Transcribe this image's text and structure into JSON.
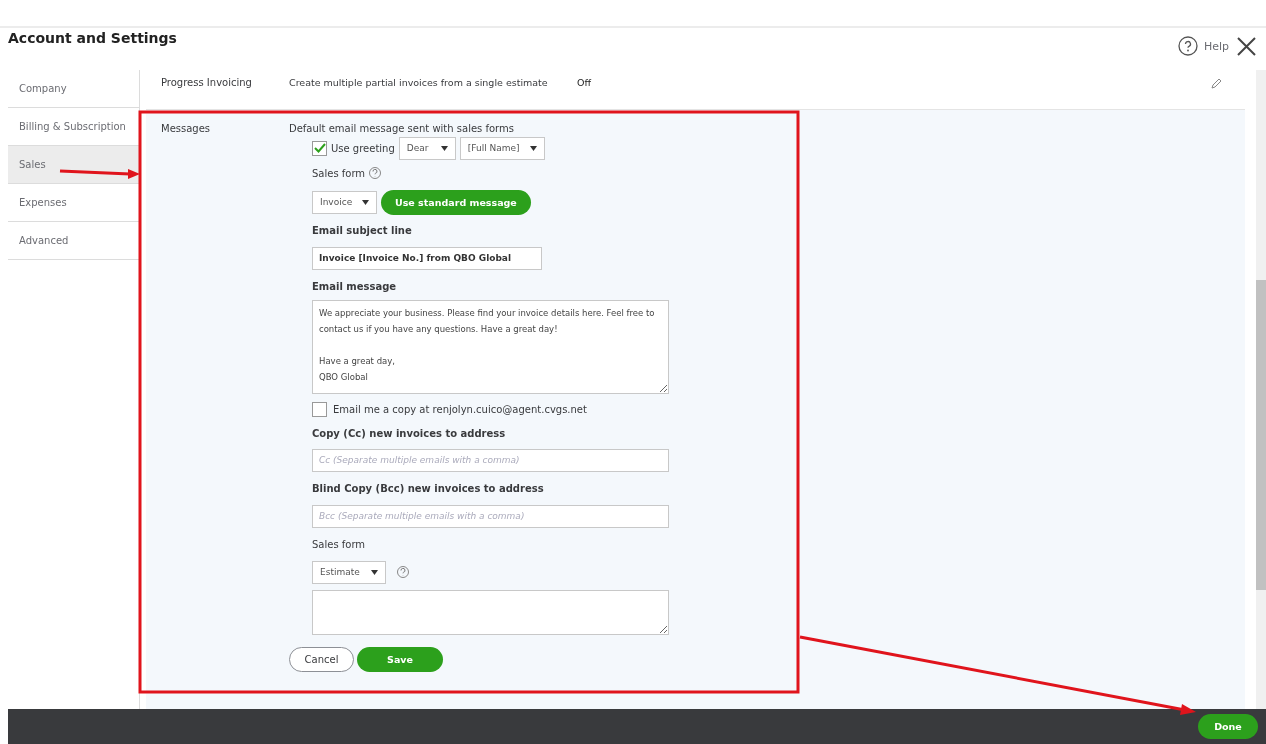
{
  "header": {
    "title": "Account and Settings",
    "help": "Help"
  },
  "sidebar": {
    "items": [
      {
        "label": "Company",
        "selected": false
      },
      {
        "label": "Billing & Subscription",
        "selected": false
      },
      {
        "label": "Sales",
        "selected": true
      },
      {
        "label": "Expenses",
        "selected": false
      },
      {
        "label": "Advanced",
        "selected": false
      }
    ]
  },
  "progress_invoicing": {
    "label": "Progress Invoicing",
    "description": "Create multiple partial invoices from a single estimate",
    "value": "Off"
  },
  "messages": {
    "label": "Messages",
    "description": "Default email message sent with sales forms",
    "use_greeting": {
      "label": "Use greeting",
      "checked": true,
      "greeting": "Dear",
      "name": "[Full Name]"
    },
    "sales_form_label": "Sales form",
    "sales_form": "Invoice",
    "standard_button": "Use standard message",
    "subject_label": "Email subject line",
    "subject": "Invoice [Invoice No.] from QBO Global",
    "message_label": "Email message",
    "message": "We appreciate your business. Please find your invoice details here. Feel free to contact us if you have any questions. Have a great day!\n\nHave a great day,\nQBO Global",
    "copy_me": {
      "label": "Email me a copy at renjolyn.cuico@agent.cvgs.net",
      "checked": false
    },
    "cc_label": "Copy (Cc) new invoices to address",
    "cc_placeholder": "Cc (Separate multiple emails with a comma)",
    "bcc_label": "Blind Copy (Bcc) new invoices to address",
    "bcc_placeholder": "Bcc (Separate multiple emails with a comma)",
    "sales_form2_label": "Sales form",
    "sales_form2": "Estimate",
    "cancel": "Cancel",
    "save": "Save"
  },
  "footer": {
    "done": "Done"
  }
}
